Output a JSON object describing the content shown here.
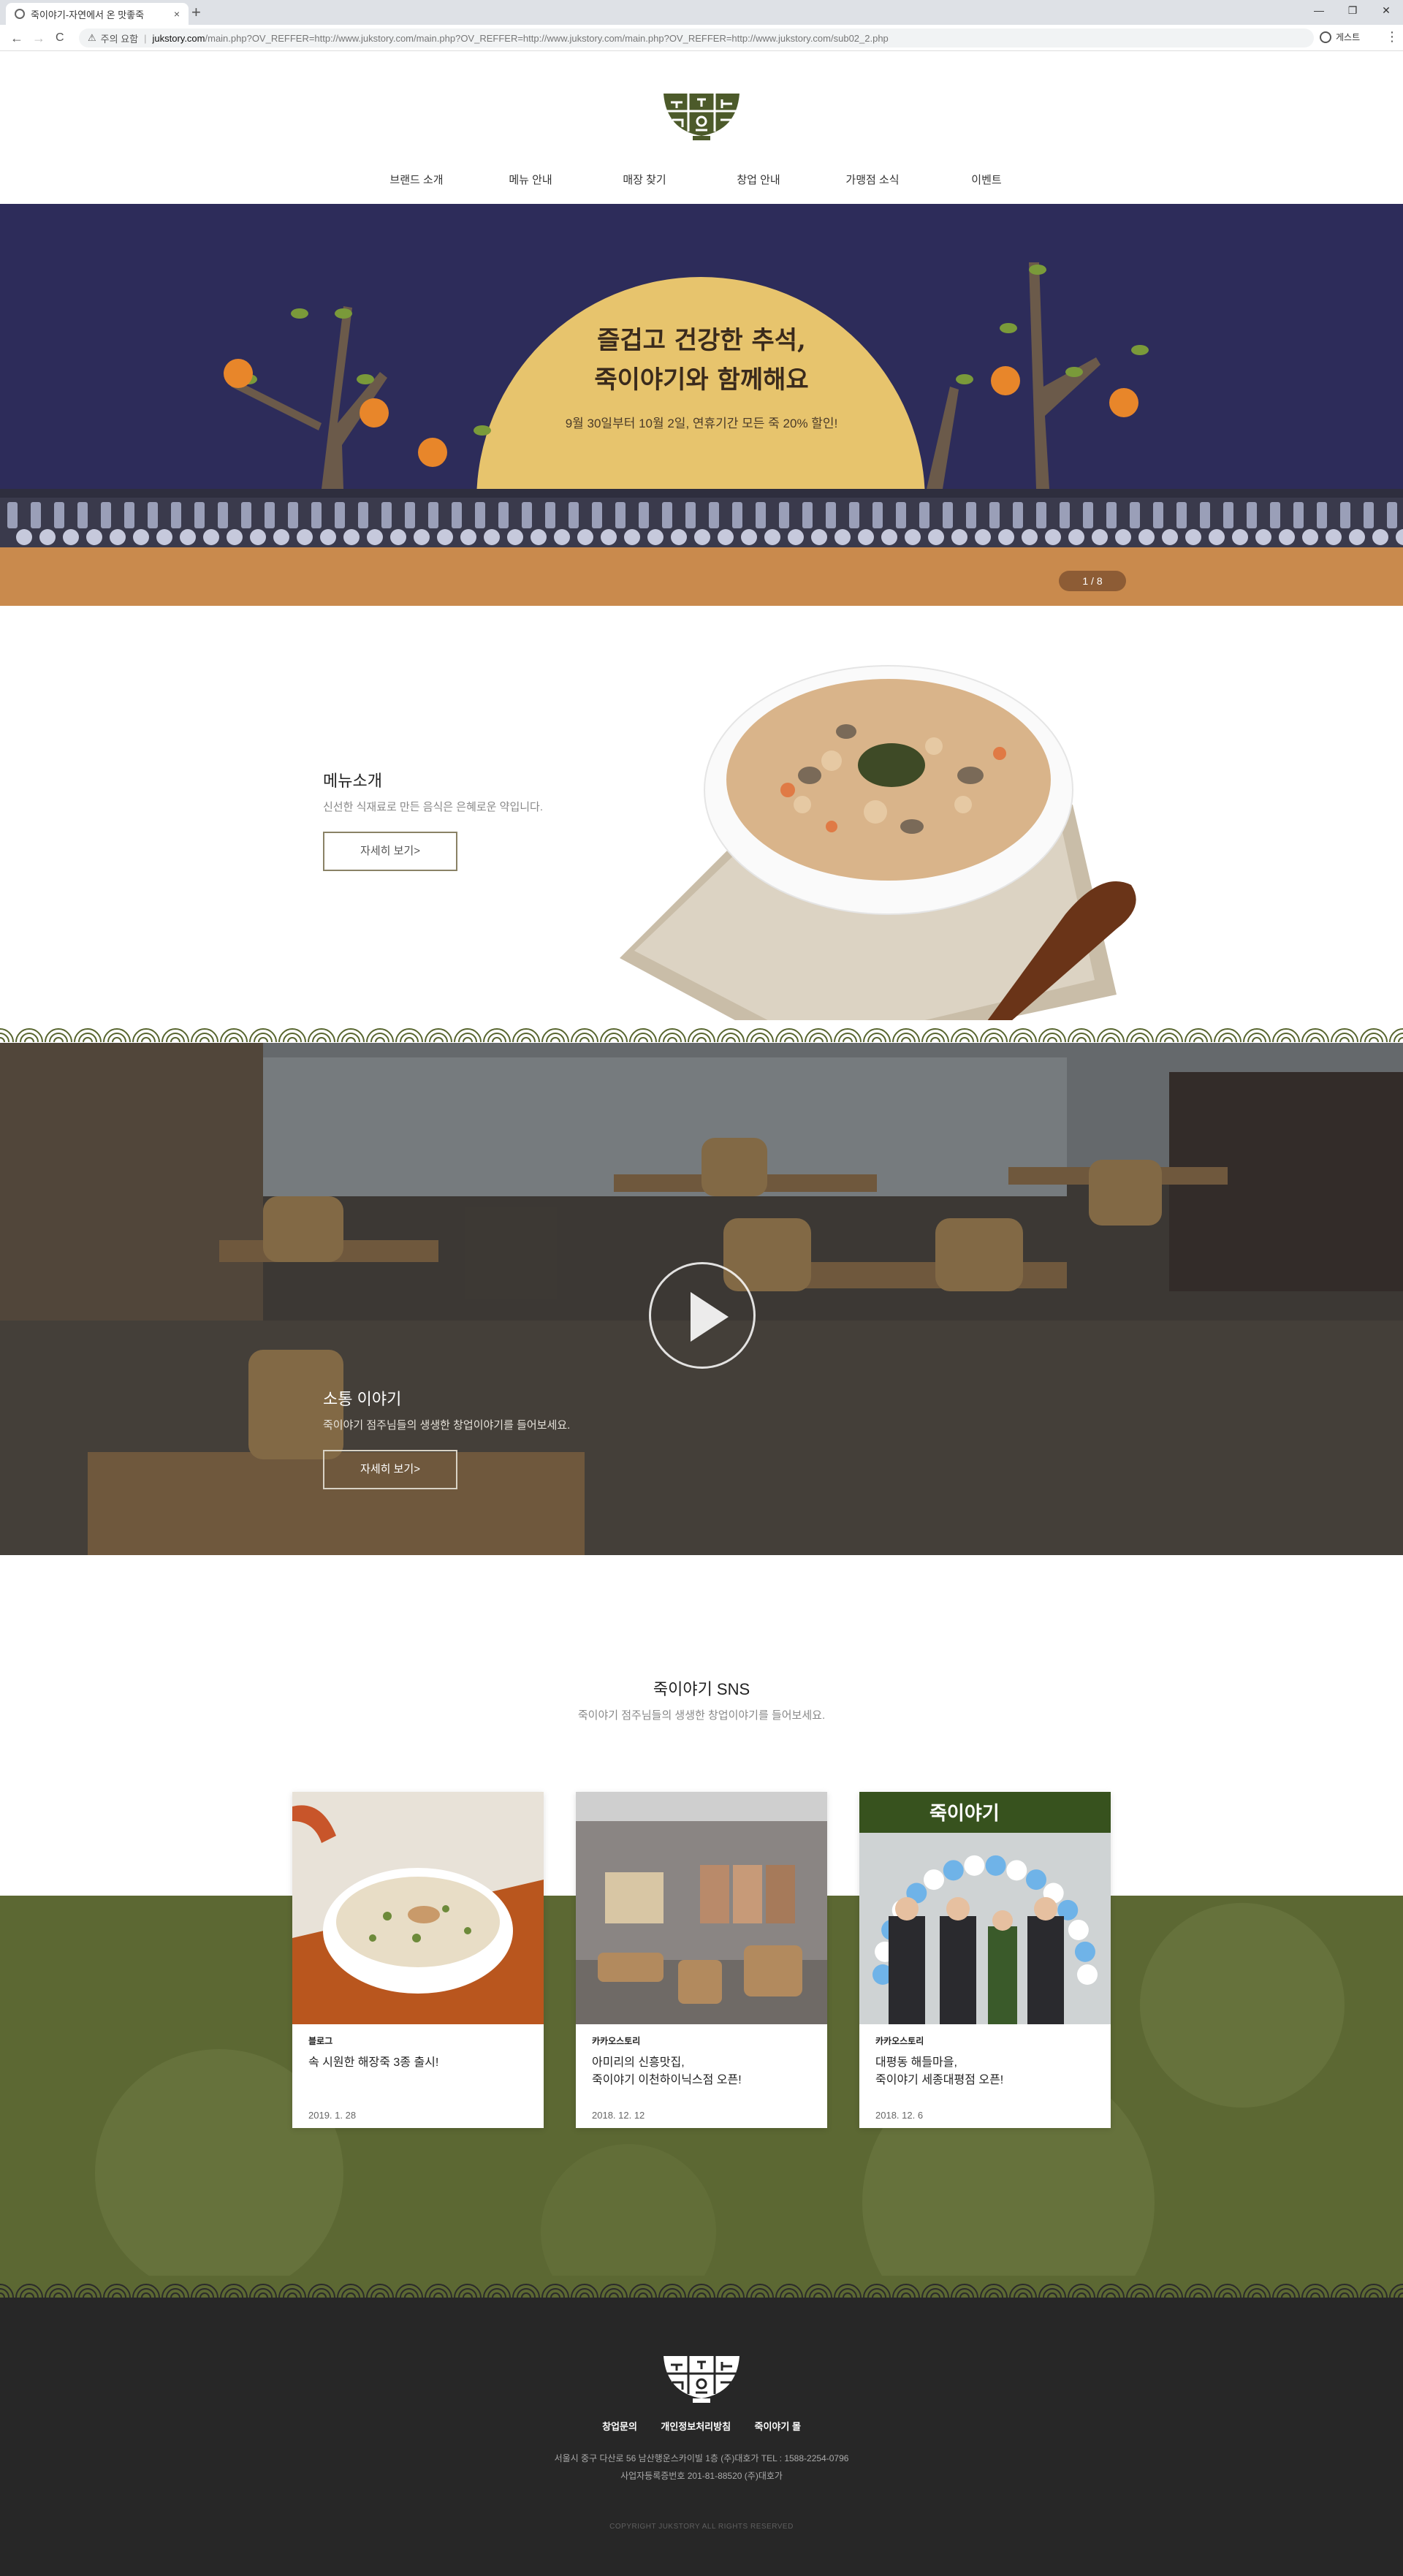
{
  "browser": {
    "tab_title": "죽이야기-자연에서 온 맛좋죽",
    "tab_close": "×",
    "new_tab": "+",
    "back": "←",
    "forward": "→",
    "reload": "C",
    "security": "주의 요함",
    "url_host": "jukstory.com",
    "url_path": "/main.php?OV_REFFER=http://www.jukstory.com/main.php?OV_REFFER=http://www.jukstory.com/main.php?OV_REFFER=http://www.jukstory.com/sub02_2.php",
    "profile": "게스트",
    "menu": "⋮",
    "window_controls": [
      "—",
      "❐",
      "✕"
    ]
  },
  "header": {
    "logo_alt": "죽이야기",
    "nav": [
      {
        "label": "브랜드 소개"
      },
      {
        "label": "메뉴 안내"
      },
      {
        "label": "매장 찾기"
      },
      {
        "label": "창업 안내"
      },
      {
        "label": "가맹점 소식"
      },
      {
        "label": "이벤트"
      }
    ]
  },
  "hero": {
    "title": "즐겁고 건강한 추석,\n죽이야기와 함께해요",
    "subtitle": "9월 30일부터 10월 2일, 연휴기간 모든 죽 20% 할인!",
    "indicator": "1 / 8",
    "colors": {
      "sky": "#2d2c5a",
      "moon": "#e7c46d",
      "ground": "#c98a4d"
    }
  },
  "menu_intro": {
    "title": "메뉴소개",
    "desc": "신선한 식재료로 만든 음식은 은혜로운 약입니다.",
    "button": "자세히 보기>"
  },
  "story": {
    "title": "소통 이야기",
    "desc": "죽이야기 점주님들의 생생한 창업이야기를 들어보세요.",
    "button": "자세히 보기>"
  },
  "sns": {
    "title": "죽이야기 SNS",
    "desc": "죽이야기 점주님들의 생생한 창업이야기를 들어보세요.",
    "cards": [
      {
        "category": "블로그",
        "title": "속 시원한 해장죽 3종 출시!",
        "date": "2019. 1. 28"
      },
      {
        "category": "카카오스토리",
        "title": "아미리의 신흥맛집,\n죽이야기 이천하이닉스점 오픈!",
        "date": "2018. 12. 12"
      },
      {
        "category": "카카오스토리",
        "title": "대평동 해들마을,\n죽이야기 세종대평점 오픈!",
        "date": "2018. 12. 6"
      }
    ],
    "store_sign": "죽이야기"
  },
  "footer": {
    "links": [
      {
        "label": "창업문의"
      },
      {
        "label": "개인정보처리방침"
      },
      {
        "label": "죽이야기 몰"
      }
    ],
    "address": "서울시 중구 다산로 56 남산행운스카이빌 1층 (주)대호가 TEL : 1588-2254-0796",
    "biz": "사업자등록증번호 201-81-88520 (주)대호가",
    "copyright": "COPYRIGHT JUKSTORY ALL RIGHTS RESERVED"
  }
}
